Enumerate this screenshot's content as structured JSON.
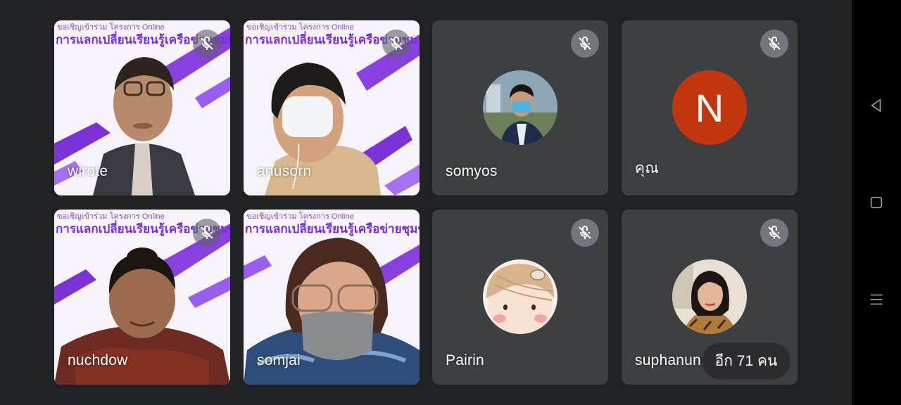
{
  "banner": {
    "line1": "ขอเชิญเข้าร่วม โครงการ Online",
    "line2": "การแลกเปลี่ยนเรียนรู้เครือข่ายชุมชน"
  },
  "participants": [
    {
      "name": "wirote",
      "muted": true,
      "type": "video"
    },
    {
      "name": "anusorn",
      "muted": true,
      "type": "video"
    },
    {
      "name": "somyos",
      "muted": true,
      "type": "photo-avatar"
    },
    {
      "name": "คุณ",
      "muted": true,
      "type": "letter-avatar",
      "initial": "N",
      "avatar_color": "#c3360f"
    },
    {
      "name": "nuchdow",
      "muted": true,
      "type": "video"
    },
    {
      "name": "somjai",
      "muted": true,
      "type": "video"
    },
    {
      "name": "Pairin",
      "muted": true,
      "type": "photo-avatar"
    },
    {
      "name": "suphanun",
      "muted": true,
      "type": "photo-avatar"
    }
  ],
  "more_participants": {
    "label": "อีก 71 คน"
  },
  "icons": {
    "mute": "mic-off-icon",
    "back": "back-triangle-icon",
    "home": "home-square-icon",
    "recents": "menu-lines-icon"
  },
  "colors": {
    "background": "#202124",
    "tile": "#3c4043",
    "accent_purple": "#7a2bd8"
  }
}
